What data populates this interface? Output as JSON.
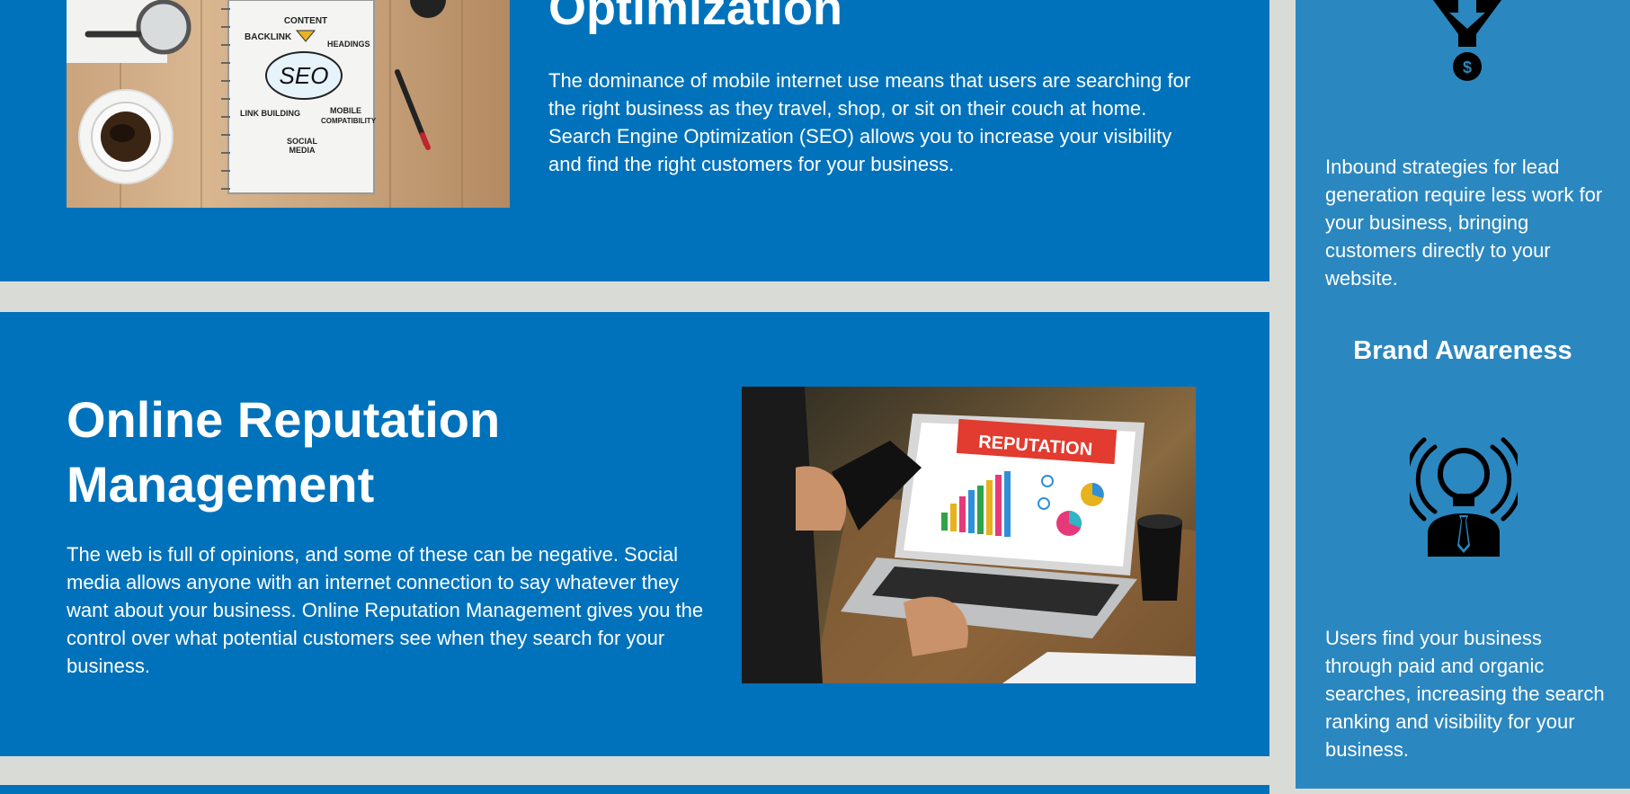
{
  "seo": {
    "title": "Optimization",
    "text": "The dominance of mobile internet use means that users are searching for the right business as they travel, shop, or sit on their couch at home. Search Engine Optimization (SEO) allows you to increase your visibility and find the right customers for your business.",
    "image_labels": {
      "content": "CONTENT",
      "backlink": "BACKLINK",
      "headings": "HEADINGS",
      "seo": "SEO",
      "link_building": "LINK BUILDING",
      "mobile": "MOBILE",
      "compatibility": "COMPATIBILITY",
      "social": "SOCIAL",
      "media": "MEDIA"
    }
  },
  "orm": {
    "title": "Online Reputation Management",
    "text": "The web is full of opinions, and some of these can be negative. Social media allows anyone with an internet connection to say whatever they want about your business. Online Reputation Management gives you the control over what potential customers see when they search for your business.",
    "image_label": "REPUTATION"
  },
  "sidebar": {
    "lead_text": "Inbound strategies for lead generation require less work for your business, bringing customers directly to your website.",
    "brand_heading": "Brand Awareness",
    "brand_text": "Users find your business through paid and organic searches, increasing the search ranking and visibility for your business.",
    "icons": [
      "funnel-dollar-icon",
      "lightbulb-person-icon"
    ]
  },
  "colors": {
    "section_blue": "#0072bb",
    "sidebar_blue": "#2b87bf",
    "background_gray": "#d9dcd6"
  }
}
